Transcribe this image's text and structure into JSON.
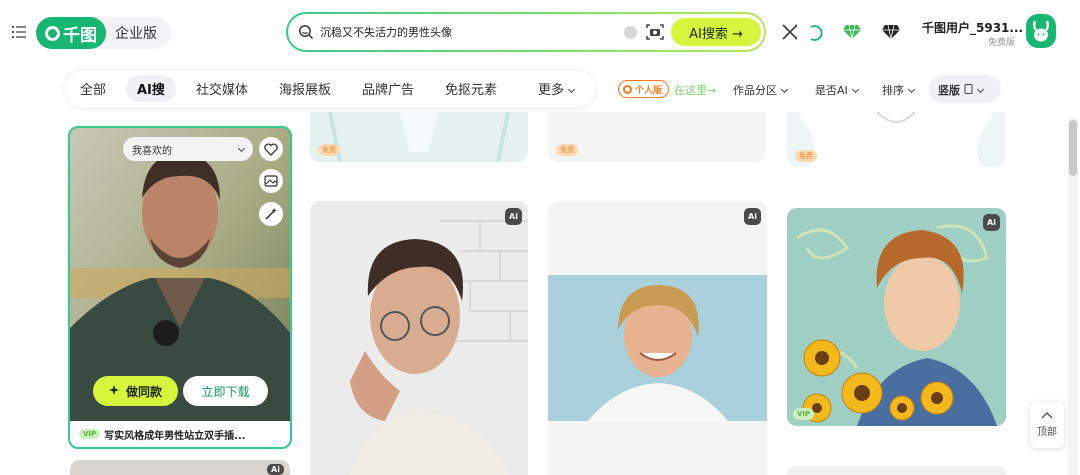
{
  "brand": {
    "sub": "企业版"
  },
  "search": {
    "query": "沉稳又不失活力的男性头像",
    "ai_button": "AI搜索 →"
  },
  "user": {
    "name": "千图用户_5931...",
    "tag": "免费版"
  },
  "tabs": [
    "全部",
    "AI搜",
    "社交媒体",
    "海报展板",
    "品牌广告",
    "免抠元素",
    "更多"
  ],
  "active_tab": "AI搜",
  "personal": {
    "badge": "个人版",
    "link": "在这里→"
  },
  "filters": [
    "作品分区",
    "是否AI",
    "排序",
    "竖版"
  ],
  "featured_card": {
    "dropdown": "我喜欢的",
    "make_same": "做同款",
    "download": "立即下载",
    "vip": "VIP",
    "title": "写实风格成年男性站立双手插..."
  },
  "tags": {
    "free": "免费",
    "vip": "VIP",
    "ai": "Ai"
  },
  "back_to_top": "顶部",
  "colors": {
    "brand_green": "#17b673",
    "accent_lime": "#d6f63d",
    "orange": "#ff7a1a"
  }
}
